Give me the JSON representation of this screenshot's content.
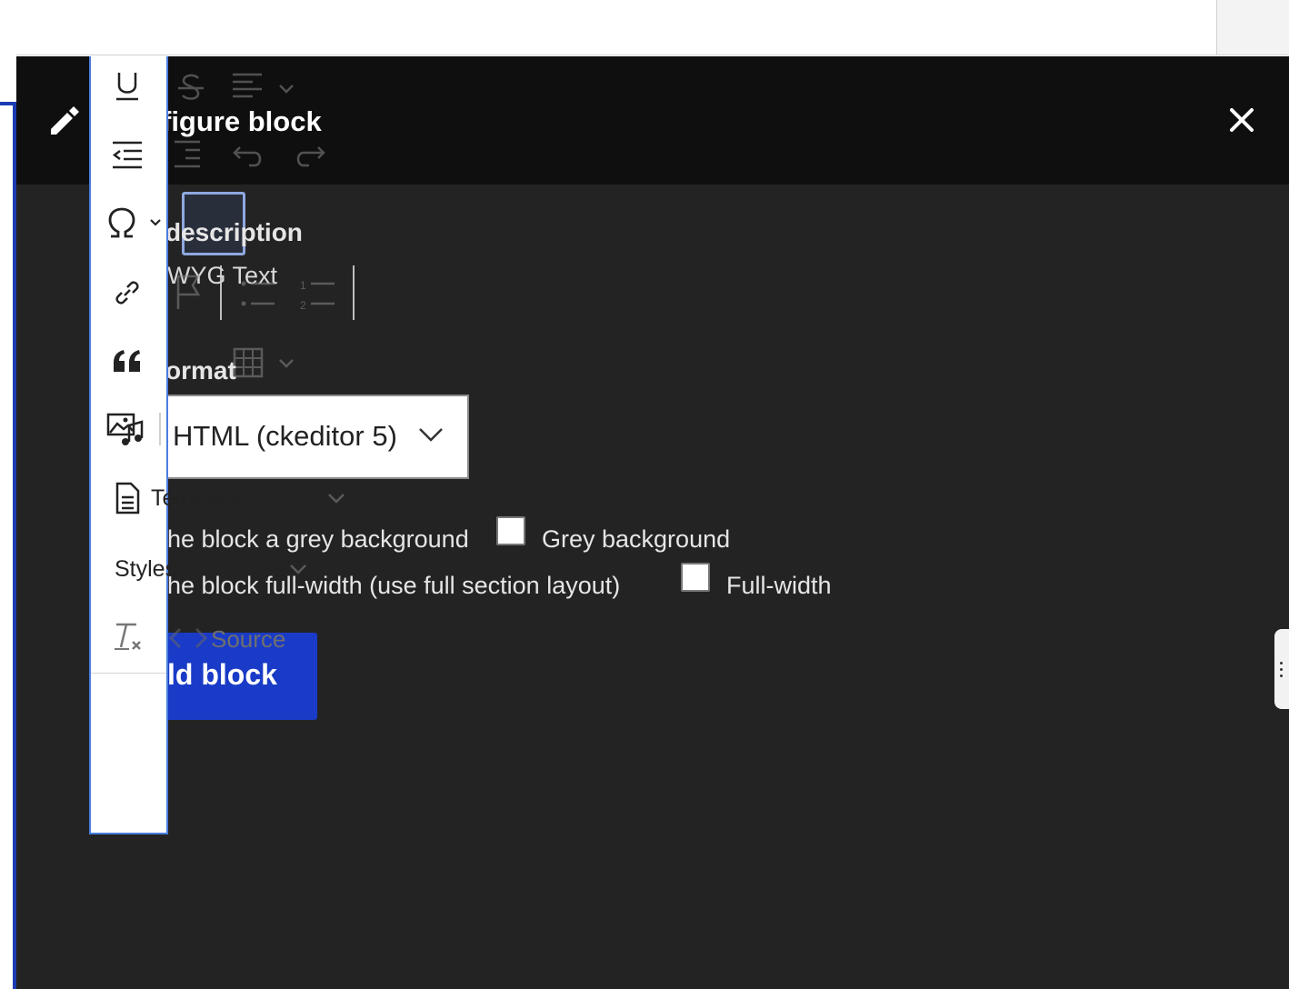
{
  "dialog": {
    "title": "Configure block",
    "title_visible": "figure block",
    "close_icon": "close-icon",
    "edit_icon": "pencil-icon"
  },
  "form": {
    "description_label": "description",
    "description_visible": "description",
    "wysiwyg_label": "WYG Text",
    "format_label": "ormat",
    "format_value": "HTML (ckeditor 5)",
    "grey_bg_label": "he block a grey background",
    "grey_bg_option": "Grey background",
    "grey_bg_checked": false,
    "full_width_label": "he block full-width (use full section layout)",
    "full_width_option": "Full-width",
    "full_width_checked": false,
    "submit_label": "ld block"
  },
  "toolbar_overflow": {
    "items": [
      {
        "icon": "underline-icon"
      },
      {
        "icon": "outdent-icon"
      },
      {
        "icon": "special-characters-icon"
      },
      {
        "icon": "link-icon"
      },
      {
        "icon": "blockquote-icon"
      },
      {
        "icon": "media-icon"
      },
      {
        "icon": "template-icon",
        "label": "Template"
      },
      {
        "label": "Styles"
      },
      {
        "icon": "remove-format-icon"
      }
    ],
    "template_label": "Template",
    "styles_label": "Styles",
    "source_label": "Source"
  },
  "colors": {
    "dialog_bg": "#232323",
    "header_bg": "#0f0f0f",
    "accent": "#1a3bc7",
    "focus": "#4a7de0"
  }
}
